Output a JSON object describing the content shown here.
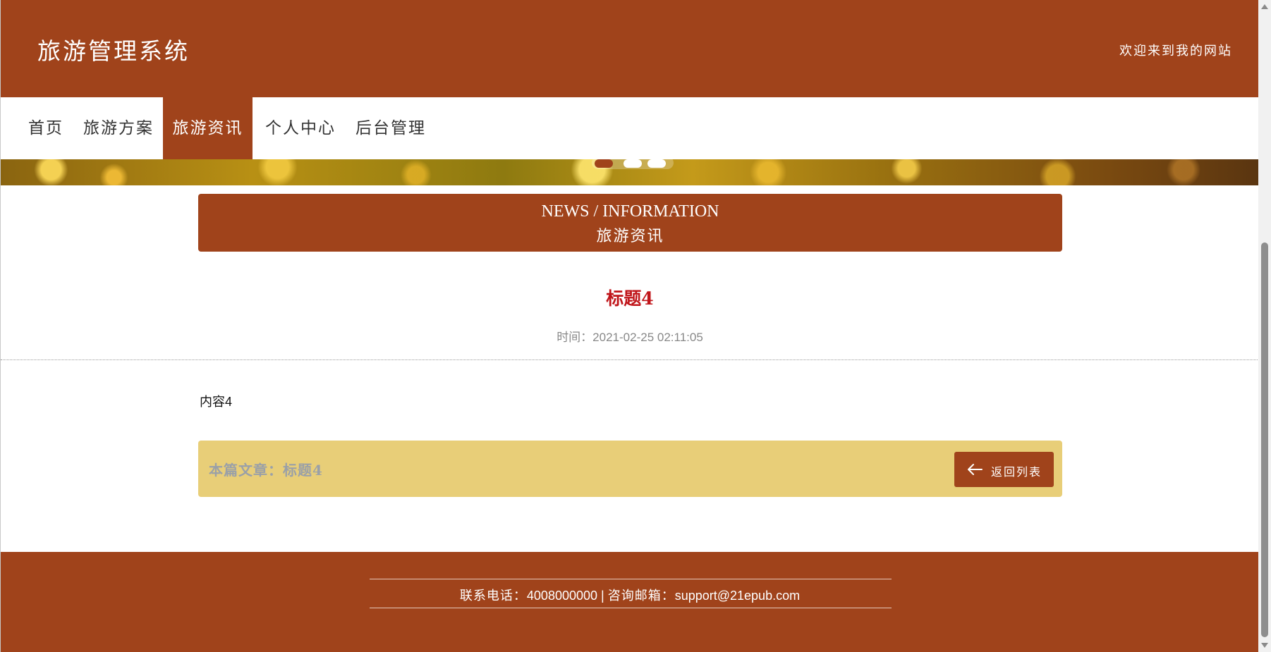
{
  "header": {
    "site_title": "旅游管理系统",
    "welcome": "欢迎来到我的网站"
  },
  "nav": {
    "items": [
      {
        "label": "首页",
        "active": false
      },
      {
        "label": "旅游方案",
        "active": false
      },
      {
        "label": "旅游资讯",
        "active": true
      },
      {
        "label": "个人中心",
        "active": false
      },
      {
        "label": "后台管理",
        "active": false
      }
    ]
  },
  "banner": {
    "carousel_count": 3,
    "carousel_active": 1
  },
  "section": {
    "title_en": "NEWS / INFORMATION",
    "title_cn": "旅游资讯"
  },
  "article": {
    "title": "标题4",
    "time": "时间：2021-02-25 02:11:05",
    "content": "内容4",
    "current_label": "本篇文章：标题4",
    "back_button": "返回列表",
    "back_icon": "arrow-left-icon"
  },
  "footer": {
    "phone_label": "联系电话：",
    "phone": "4008000000",
    "separator": " | ",
    "email_label": "咨询邮箱：",
    "email": "support@21epub.com"
  },
  "colors": {
    "brand": "#a0431b",
    "title_red": "#c0151a",
    "bar_yellow": "#e8ce78",
    "muted_gray": "#9aa0a8"
  }
}
